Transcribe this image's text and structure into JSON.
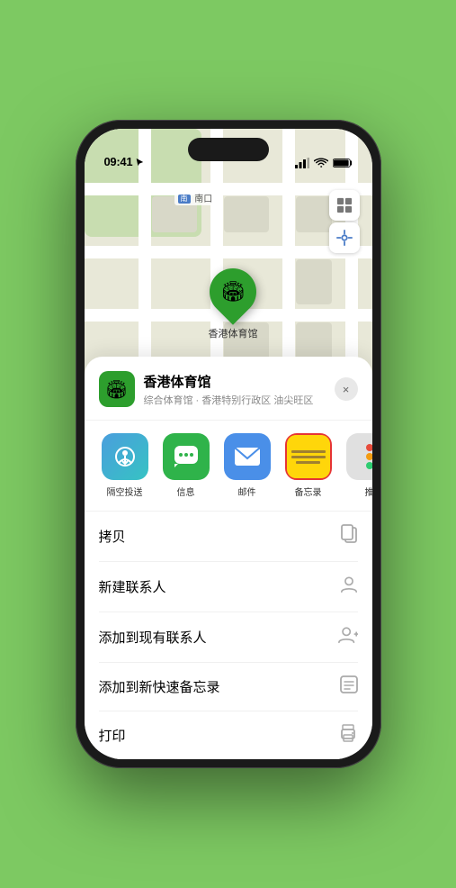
{
  "status_bar": {
    "time": "09:41",
    "location_arrow": true
  },
  "map": {
    "label_text": "南口",
    "stadium_name": "香港体育馆",
    "pin_emoji": "🏟️"
  },
  "map_controls": {
    "map_icon": "🗺",
    "location_icon": "⊙"
  },
  "bottom_sheet": {
    "venue_name": "香港体育馆",
    "venue_desc": "综合体育馆 · 香港特别行政区 油尖旺区",
    "close_label": "×",
    "share_items": [
      {
        "id": "airdrop",
        "label": "隔空投送",
        "type": "airdrop"
      },
      {
        "id": "message",
        "label": "信息",
        "type": "message"
      },
      {
        "id": "mail",
        "label": "邮件",
        "type": "mail"
      },
      {
        "id": "notes",
        "label": "备忘录",
        "type": "notes"
      },
      {
        "id": "more",
        "label": "推",
        "type": "more"
      }
    ],
    "actions": [
      {
        "id": "copy",
        "label": "拷贝",
        "icon": "copy"
      },
      {
        "id": "new-contact",
        "label": "新建联系人",
        "icon": "person"
      },
      {
        "id": "add-contact",
        "label": "添加到现有联系人",
        "icon": "person-add"
      },
      {
        "id": "quick-note",
        "label": "添加到新快速备忘录",
        "icon": "note"
      },
      {
        "id": "print",
        "label": "打印",
        "icon": "print"
      }
    ]
  }
}
